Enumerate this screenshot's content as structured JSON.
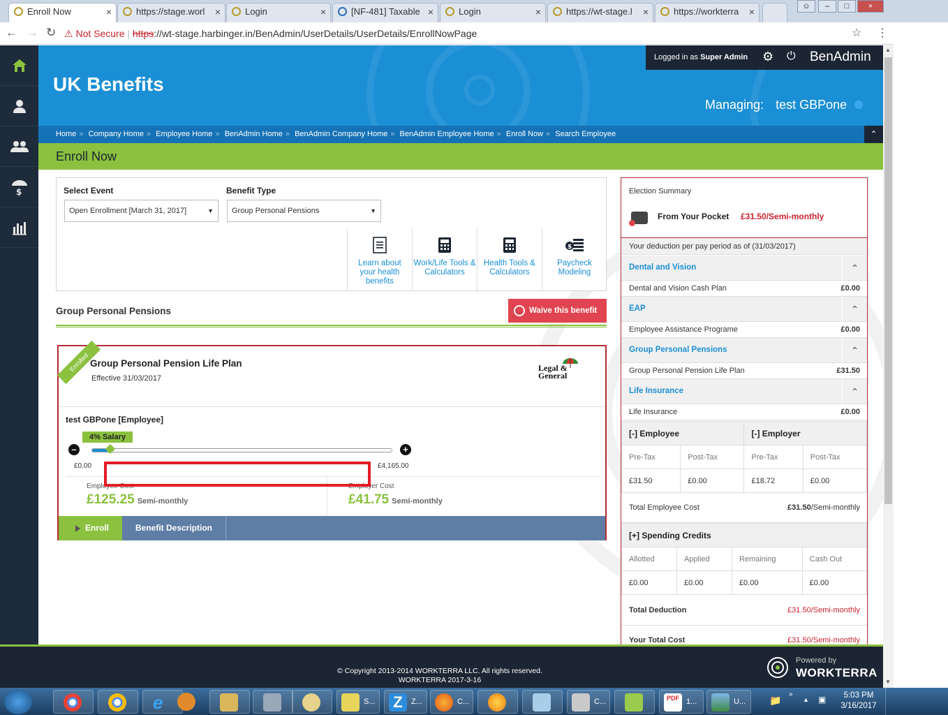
{
  "browser": {
    "tabs": [
      {
        "title": "Enroll Now"
      },
      {
        "title": "https://stage.worl"
      },
      {
        "title": "Login"
      },
      {
        "title": "[NF-481] Taxable"
      },
      {
        "title": "Login"
      },
      {
        "title": "https://wt-stage.l"
      },
      {
        "title": "https://workterra"
      }
    ],
    "security": "Not Secure",
    "url_scheme": "https",
    "url_rest": "://wt-stage.harbinger.in/BenAdmin/UserDetails/UserDetails/EnrollNowPage"
  },
  "header": {
    "brand": "UK Benefits",
    "logged_in_prefix": "Logged in as",
    "logged_in_user": "Super Admin",
    "app_name": "BenAdmin",
    "managing_label": "Managing:",
    "managing_value": "test GBPone"
  },
  "breadcrumbs": [
    "Home",
    "Company Home",
    "Employee Home",
    "BenAdmin Home",
    "BenAdmin Company Home",
    "BenAdmin Employee Home",
    "Enroll Now",
    "Search Employee"
  ],
  "page_title": "Enroll Now",
  "selector": {
    "event_label": "Select Event",
    "event_value": "Open Enrollment [March 31, 2017]",
    "benefit_label": "Benefit Type",
    "benefit_value": "Group Personal Pensions",
    "tools": [
      {
        "label": "Learn about your health benefits",
        "icon": "document-icon"
      },
      {
        "label": "Work/Life Tools & Calculators",
        "icon": "calculator-icon"
      },
      {
        "label": "Health Tools & Calculators",
        "icon": "calculator-icon"
      },
      {
        "label": "Paycheck Modeling",
        "icon": "money-stack-icon"
      }
    ]
  },
  "section": {
    "title": "Group Personal Pensions",
    "waive_label": "Waive this benefit"
  },
  "plan": {
    "ribbon": "Enrolled",
    "name": "Group Personal Pension Life Plan",
    "effective": "Effective 31/03/2017",
    "logo_line1": "Legal &",
    "logo_line2": "General",
    "member": "test GBPone [Employee]",
    "salary_badge": "4% Salary",
    "slider_fraction": 0.05,
    "min_value": "£0.00",
    "max_value": "£4,165.00",
    "employee_cost_label": "Employee Cost",
    "employee_cost": "£125.25",
    "employee_cost_period": "Semi-monthly",
    "employer_cost_label": "Employer Cost",
    "employer_cost": "£41.75",
    "employer_cost_period": "Semi-monthly",
    "enroll_label": "Enroll",
    "description_label": "Benefit Description"
  },
  "summary": {
    "title": "Election Summary",
    "pocket_label": "From Your Pocket",
    "pocket_value": "£31.50/Semi-monthly",
    "as_of": "Your deduction per pay period as of (31/03/2017)",
    "sections": [
      {
        "heading": "Dental and Vision",
        "item": "Dental and Vision Cash Plan",
        "value": "£0.00"
      },
      {
        "heading": "EAP",
        "item": "Employee Assistance Programe",
        "value": "£0.00"
      },
      {
        "heading": "Group Personal Pensions",
        "item": "Group Personal Pension Life Plan",
        "value": "£31.50"
      },
      {
        "heading": "Life Insurance",
        "item": "Life Insurance",
        "value": "£0.00"
      }
    ],
    "contrib": {
      "employee_header": "[-] Employee",
      "employer_header": "[-] Employer",
      "cols": [
        "Pre-Tax",
        "Post-Tax",
        "Pre-Tax",
        "Post-Tax"
      ],
      "values": [
        "£31.50",
        "£0.00",
        "£18.72",
        "£0.00"
      ]
    },
    "total_employee_cost_label": "Total Employee Cost",
    "total_employee_cost_amount": "£31.50",
    "total_employee_cost_period": "/Semi-monthly",
    "credits": {
      "header": "[+] Spending Credits",
      "cols": [
        "Allotted",
        "Applied",
        "Remaining",
        "Cash Out"
      ],
      "values": [
        "£0.00",
        "£0.00",
        "£0.00",
        "£0.00"
      ]
    },
    "total_deduction_label": "Total Deduction",
    "total_deduction_amount": "£31.50",
    "total_deduction_period": "/Semi-monthly",
    "your_total_cost_label": "Your Total Cost",
    "your_total_cost_amount": "£31.50",
    "your_total_cost_period": "/Semi-monthly"
  },
  "footer": {
    "copyright": "© Copyright 2013-2014 WORKTERRA LLC. All rights reserved.",
    "version": "WORKTERRA 2017-3-16",
    "powered_by": "Powered by",
    "powered_brand": "WORKTERRA"
  },
  "taskbar": {
    "items": [
      {
        "label": ""
      },
      {
        "label": ""
      },
      {
        "label": ""
      },
      {
        "label": ""
      },
      {
        "label": ""
      },
      {
        "label": ""
      },
      {
        "label": ""
      },
      {
        "label": "S..."
      },
      {
        "label": "Z..."
      },
      {
        "label": "C..."
      },
      {
        "label": ""
      },
      {
        "label": ""
      },
      {
        "label": "C..."
      },
      {
        "label": ""
      },
      {
        "label": "1..."
      },
      {
        "label": "U..."
      }
    ],
    "time": "5:03 PM",
    "date": "3/16/2017"
  },
  "colors": {
    "accent_green": "#8bc13f",
    "header_blue": "#1b8fd5",
    "dark_navy": "#1c2533",
    "alert_red": "#e04450"
  }
}
